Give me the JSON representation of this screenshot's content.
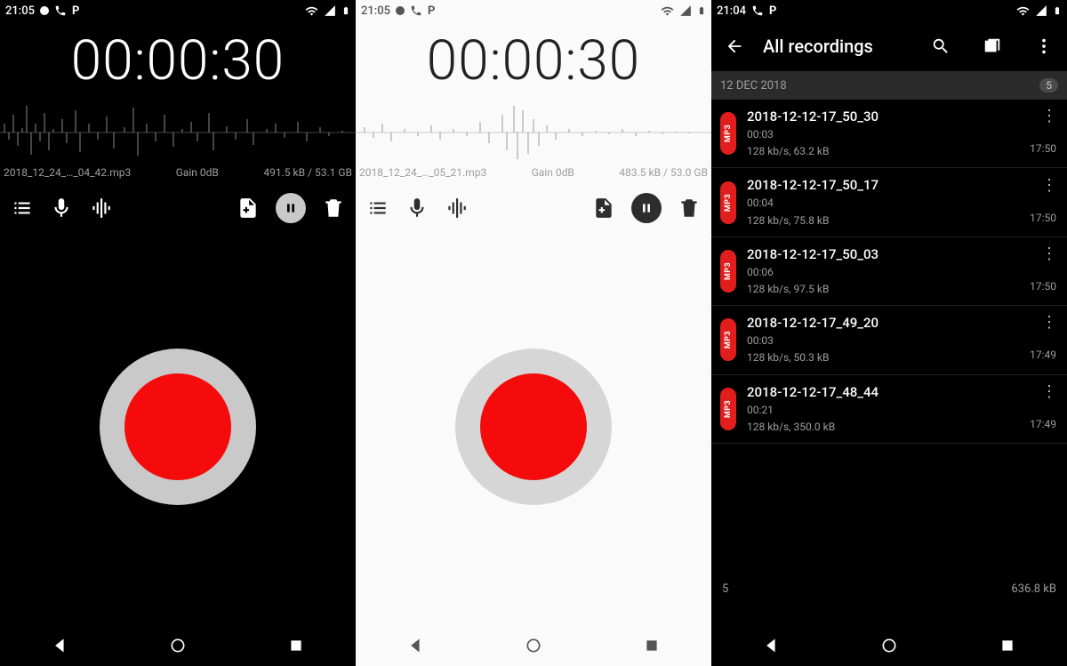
{
  "screens": {
    "dark": {
      "status_time": "21:05",
      "timer": "00:00:30",
      "filename": "2018_12_24_…_04_42.mp3",
      "gain": "Gain 0dB",
      "size_info": "491.5 kB / 53.1 GB"
    },
    "light": {
      "status_time": "21:05",
      "timer": "00:00:30",
      "filename": "2018_12_24_…_05_21.mp3",
      "gain": "Gain 0dB",
      "size_info": "483.5 kB / 53.0 GB"
    },
    "list": {
      "status_time": "21:04",
      "title": "All recordings",
      "date_header": "12 DEC 2018",
      "date_count": "5",
      "items": [
        {
          "title": "2018-12-12-17_50_30",
          "duration": "00:03",
          "details": "128 kb/s, 63.2 kB",
          "time": "17:50",
          "format": "MP3"
        },
        {
          "title": "2018-12-12-17_50_17",
          "duration": "00:04",
          "details": "128 kb/s, 75.8 kB",
          "time": "17:50",
          "format": "MP3"
        },
        {
          "title": "2018-12-12-17_50_03",
          "duration": "00:06",
          "details": "128 kb/s, 97.5 kB",
          "time": "17:50",
          "format": "MP3"
        },
        {
          "title": "2018-12-12-17_49_20",
          "duration": "00:03",
          "details": "128 kb/s, 50.3 kB",
          "time": "17:49",
          "format": "MP3"
        },
        {
          "title": "2018-12-12-17_48_44",
          "duration": "00:21",
          "details": "128 kb/s, 350.0 kB",
          "time": "17:49",
          "format": "MP3"
        }
      ],
      "summary_count": "5",
      "summary_size": "636.8 kB"
    }
  }
}
